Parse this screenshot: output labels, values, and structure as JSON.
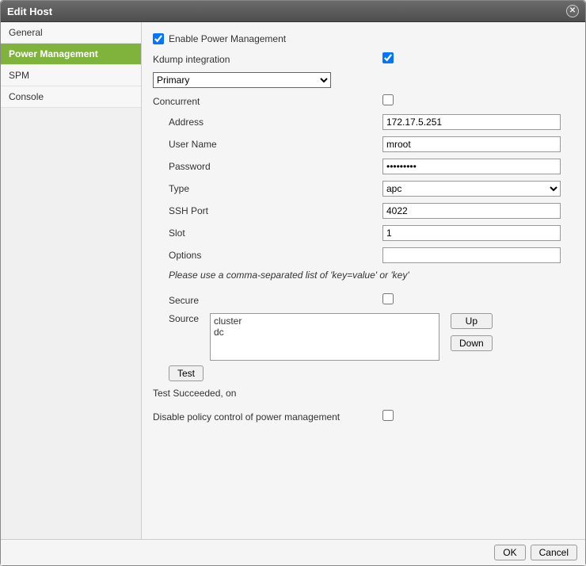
{
  "dialog": {
    "title": "Edit Host"
  },
  "sidebar": {
    "items": [
      {
        "label": "General"
      },
      {
        "label": "Power Management"
      },
      {
        "label": "SPM"
      },
      {
        "label": "Console"
      }
    ]
  },
  "form": {
    "enable_pm_label": "Enable Power Management",
    "kdump_label": "Kdump integration",
    "primary_select": "Primary",
    "concurrent_label": "Concurrent",
    "address_label": "Address",
    "address_value": "172.17.5.251",
    "username_label": "User Name",
    "username_value": "mroot",
    "password_label": "Password",
    "password_value": "•••••••••",
    "type_label": "Type",
    "type_value": "apc",
    "sshport_label": "SSH Port",
    "sshport_value": "4022",
    "slot_label": "Slot",
    "slot_value": "1",
    "options_label": "Options",
    "options_value": "",
    "options_hint": "Please use a comma-separated list of 'key=value' or 'key'",
    "secure_label": "Secure",
    "source_label": "Source",
    "source_items": [
      "cluster",
      "dc"
    ],
    "up_label": "Up",
    "down_label": "Down",
    "test_label": "Test",
    "test_status": "Test Succeeded, on",
    "disable_policy_label": "Disable policy control of power management"
  },
  "footer": {
    "ok": "OK",
    "cancel": "Cancel"
  }
}
